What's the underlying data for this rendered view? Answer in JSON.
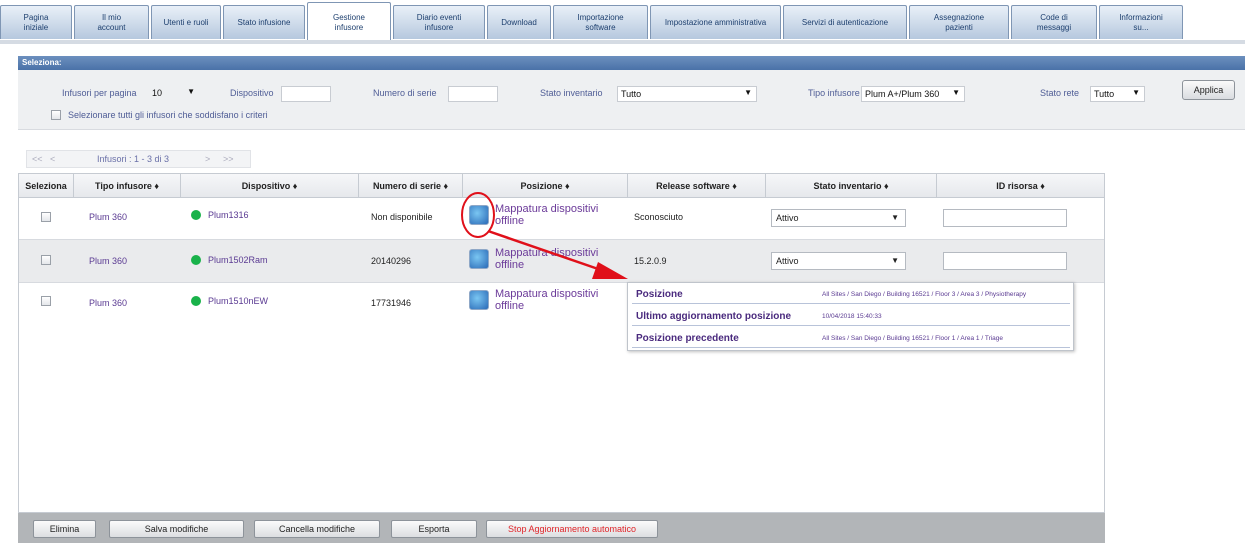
{
  "tabs": [
    {
      "label": "Pagina\niniziale",
      "active": false
    },
    {
      "label": "Il mio\naccount",
      "active": false
    },
    {
      "label": "Utenti e ruoli",
      "active": false
    },
    {
      "label": "Stato infusione",
      "active": false
    },
    {
      "label": "Gestione\ninfusore",
      "active": true
    },
    {
      "label": "Diario eventi\ninfusore",
      "active": false
    },
    {
      "label": "Download",
      "active": false
    },
    {
      "label": "Importazione\nsoftware",
      "active": false
    },
    {
      "label": "Impostazione amministrativa",
      "active": false
    },
    {
      "label": "Servizi di autenticazione",
      "active": false
    },
    {
      "label": "Assegnazione\npazienti",
      "active": false
    },
    {
      "label": "Code di\nmessaggi",
      "active": false
    },
    {
      "label": "Informazioni\nsu...",
      "active": false
    }
  ],
  "filters": {
    "header": "Seleziona:",
    "per_page_label": "Infusori per pagina",
    "per_page_value": "10",
    "device_label": "Dispositivo",
    "device_value": "",
    "serial_label": "Numero di serie",
    "serial_value": "",
    "inventory_label": "Stato inventario",
    "inventory_value": "Tutto",
    "pump_type_label": "Tipo infusore",
    "pump_type_value": "Plum A+/Plum 360",
    "network_label": "Stato rete",
    "network_value": "Tutto",
    "apply_label": "Applica",
    "select_all_label": "Selezionare tutti gli infusori che soddisfano i criteri"
  },
  "pager": {
    "first": "<<",
    "prev": "<",
    "info": "Infusori : 1 - 3 di 3",
    "next": ">",
    "last": ">>"
  },
  "table": {
    "columns": [
      "Seleziona",
      "Tipo infusore ♦",
      "Dispositivo ♦",
      "Numero di serie ♦",
      "Posizione ♦",
      "Release software ♦",
      "Stato inventario ♦",
      "ID risorsa ♦"
    ],
    "rows": [
      {
        "type": "Plum 360",
        "device": "Plum1316",
        "serial": "Non disponibile",
        "position": "Mappatura dispositivi offline",
        "software": "Sconosciuto",
        "inventory": "Attivo",
        "asset_id": ""
      },
      {
        "type": "Plum 360",
        "device": "Plum1502Ram",
        "serial": "20140296",
        "position": "Mappatura dispositivi offline",
        "software": "15.2.0.9",
        "inventory": "Attivo",
        "asset_id": ""
      },
      {
        "type": "Plum 360",
        "device": "Plum1510nEW",
        "serial": "17731946",
        "position": "Mappatura dispositivi offline",
        "software": "",
        "inventory": "",
        "asset_id": ""
      }
    ]
  },
  "popup": {
    "rows": [
      {
        "label": "Posizione",
        "value": "All Sites / San Diego / Building 16521 / Floor 3 / Area 3 / Physiotherapy"
      },
      {
        "label": "Ultimo aggiornamento posizione",
        "value": "10/04/2018 15:40:33"
      },
      {
        "label": "Posizione precedente",
        "value": "All Sites / San Diego / Building 16521 / Floor 1 / Area 1 / Triage"
      }
    ]
  },
  "actions": {
    "delete": "Elimina",
    "save": "Salva modifiche",
    "cancel": "Cancella modifiche",
    "export": "Esporta",
    "stop_auto": "Stop Aggiornamento automatico"
  },
  "colors": {
    "accent": "#4a72a8",
    "link": "#5a3a92",
    "online": "#19b24a",
    "annotation": "#e0101a"
  }
}
